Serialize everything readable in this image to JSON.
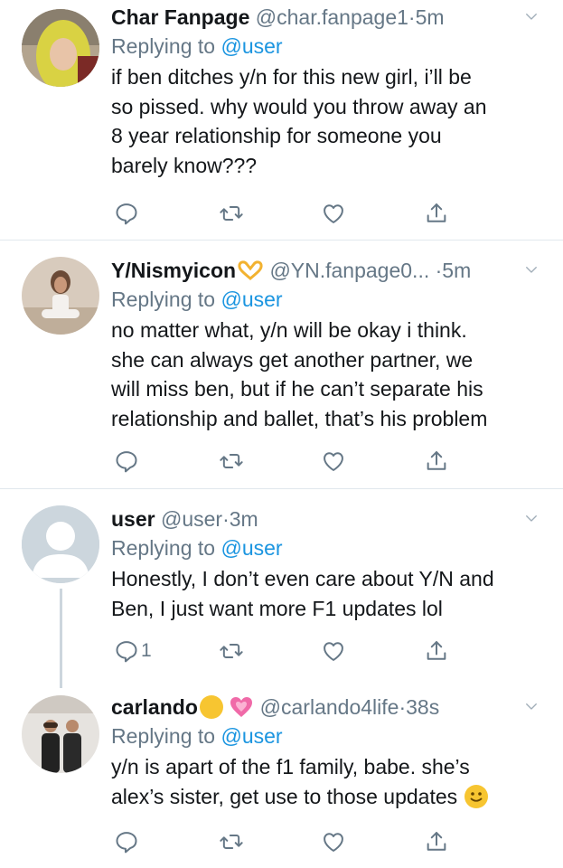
{
  "replying_label": "Replying to",
  "tweets": [
    {
      "name": "Char Fanpage",
      "handle": "@char.fanpage1",
      "separator": "·",
      "time": "5m",
      "mention": "@user",
      "text_lines": [
        "if ben ditches y/n for this new girl, i’ll be",
        "so pissed. why would you throw away an",
        "8 year relationship for someone you",
        "barely know???"
      ],
      "reply_count": ""
    },
    {
      "name": "Y/Nismyicon",
      "handle": "@YN.fanpage0...",
      "separator": "·",
      "time": "5m",
      "mention": "@user",
      "text_lines": [
        "no matter what, y/n will be okay i think.",
        "she can always get another partner, we",
        "will miss ben, but if he can’t separate his",
        "relationship and ballet, that’s his problem"
      ],
      "reply_count": ""
    },
    {
      "name": "user",
      "handle": "@user",
      "separator": "·",
      "time": "3m",
      "mention": "@user",
      "text_lines": [
        "Honestly, I don’t even care about Y/N and",
        "Ben, I just want more F1 updates lol"
      ],
      "reply_count": "1"
    },
    {
      "name": "carlando",
      "handle": "@carlando4life",
      "separator": "·",
      "time": "38s",
      "mention": "@user",
      "text_lines": [
        "y/n is apart of the f1 family, babe. she’s",
        "alex’s sister, get use to those updates"
      ],
      "reply_count": ""
    }
  ],
  "icons": {
    "reply": "reply-icon",
    "retweet": "retweet-icon",
    "like": "heart-icon",
    "share": "share-icon",
    "more": "chevron-down-icon"
  },
  "colors": {
    "name": "#14171a",
    "secondary": "#657786",
    "link": "#1b95e0",
    "divider": "#e1e8ed"
  }
}
